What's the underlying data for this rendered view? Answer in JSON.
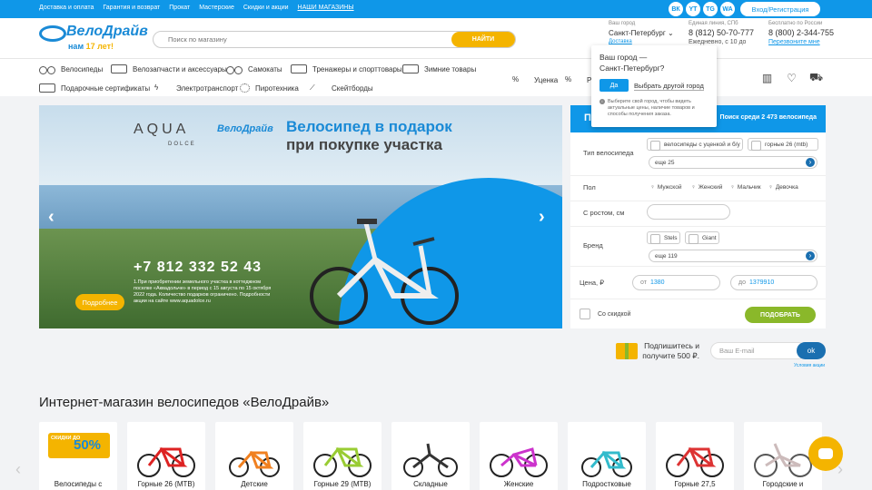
{
  "topbar": {
    "links": [
      "Доставка и оплата",
      "Гарантия и возврат",
      "Прокат",
      "Мастерские",
      "Скидки и акции",
      "НАШИ МАГАЗИНЫ"
    ],
    "social": [
      "ВК",
      "YT",
      "TG",
      "WA"
    ],
    "login": "Вход/Регистрация"
  },
  "header": {
    "logo_name": "ВелоДрайв",
    "logo_tagline_pre": "нам",
    "logo_tagline_num": "17 лет!",
    "search_placeholder": "Поиск по магазину",
    "search_button": "НАЙТИ",
    "city_label": "Ваш город",
    "city": "Санкт-Петербург",
    "city_link": "Доставка",
    "phone1_label": "Единая линия, СПб",
    "phone1": "8 (812) 50-70-777",
    "phone1_hours": "Ежедневно, с 10 до",
    "phone2_label": "Бесплатно по России",
    "phone2": "8 (800) 2-344-755",
    "phone2_link": "Перезвоните мне"
  },
  "nav": {
    "row1": [
      "Велосипеды",
      "Велозапчасти и аксессуары",
      "Самокаты",
      "Тренажеры и спорттовары",
      "Зимние товары"
    ],
    "row2": [
      "Подарочные сертификаты",
      "Электротранспорт",
      "Пиротехника",
      "Скейтборды"
    ],
    "extra": [
      "Уценка",
      "Рас"
    ]
  },
  "popup": {
    "question": "Ваш город —",
    "city": "Санкт-Петербург?",
    "yes": "Да",
    "other": "Выбрать другой город",
    "note": "Выберите свой город, чтобы видеть актуальные цены, наличие товаров и способы получения заказа."
  },
  "banner": {
    "brand": "AQUA",
    "brand_sub": "DOLCE",
    "partner": "ВелоДрайв",
    "headline1": "Велосипед в подарок",
    "headline2": "при покупке участка",
    "phone": "+7 812 332 52 43",
    "legal": "1.При приобретении земельного участка в коттеджном поселке «Аквадольче» в период с 15 августа по 15 октября 2022 года. Количество подарков ограничено. Подробности акции на сайте www.aquadolce.ru",
    "more": "Подробнее"
  },
  "filter": {
    "title": "По",
    "subtitle": "Поиск среди 2 473 велосипеда",
    "type_label": "Тип велосипеда",
    "type_chips": [
      "велосипеды с уценкой и б/у",
      "горные 26 (mtb)"
    ],
    "type_more": "еще 25",
    "gender_label": "Пол",
    "genders": [
      "Мужской",
      "Женский",
      "Мальчик",
      "Девочка"
    ],
    "height_label": "С ростом, см",
    "brand_label": "Бренд",
    "brand_chips": [
      "Stels",
      "Giant"
    ],
    "brand_more": "еще 119",
    "price_label": "Цена, ₽",
    "price_from_pre": "от",
    "price_from": "1380",
    "price_to_pre": "до",
    "price_to": "1379910",
    "discount_label": "Со скидкой",
    "apply": "ПОДОБРАТЬ"
  },
  "subscribe": {
    "text": "Подпишитесь и получите 500 ₽.",
    "placeholder": "Ваш E-mail",
    "ok": "ok",
    "terms": "Условия акции"
  },
  "section": {
    "title": "Интернет-магазин велосипедов «ВелоДрайв»",
    "promo_small": "СКИДКИ ДО",
    "promo_big": "50%",
    "cards": [
      "Велосипеды с",
      "Горные 26 (MTB)",
      "Детские",
      "Горные 29 (MTB)",
      "Складные",
      "Женские",
      "Подростковые",
      "Горные 27,5",
      "Городские и"
    ]
  },
  "colors": {
    "accent": "#0f97e8",
    "brand_dark": "#1a6fb0",
    "yellow": "#f4b400",
    "green": "#8ab82a"
  }
}
